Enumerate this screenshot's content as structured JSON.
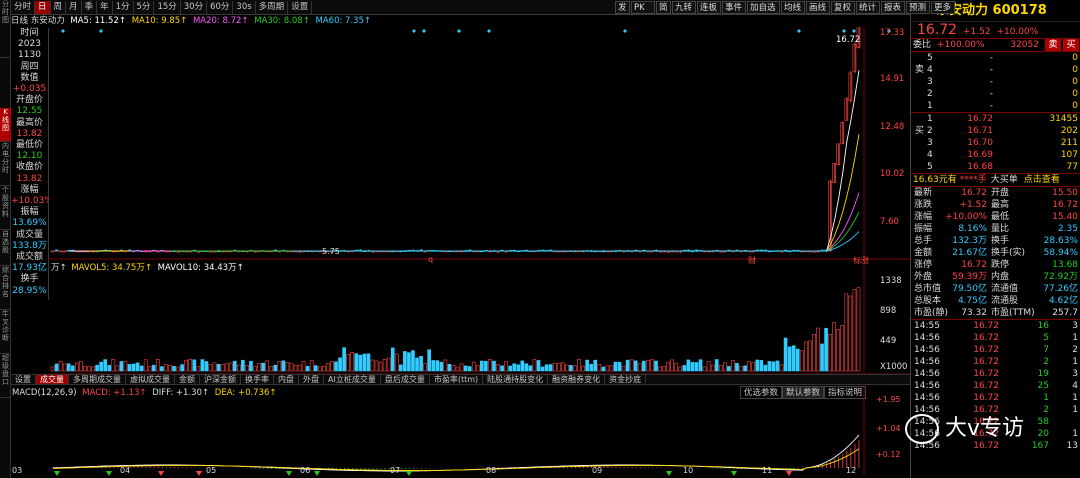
{
  "sidebar": {
    "tabs": [
      "分时图",
      "K线图",
      "内电分时",
      "个股资料",
      "自选股",
      "综合排名",
      "牛叉诊断",
      "超级盘口"
    ]
  },
  "toolbar": {
    "periods": [
      "分时",
      "日",
      "周",
      "月",
      "季",
      "年",
      "1分",
      "5分",
      "15分",
      "30分",
      "60分",
      "30s",
      "多周期",
      "设置"
    ],
    "selected": "日",
    "right_buttons": [
      "发",
      "PK",
      "简",
      "九转",
      "连板",
      "事件",
      "加自选",
      "均线",
      "画线",
      "复权",
      "统计",
      "报表",
      "预测",
      "更多"
    ]
  },
  "ma_bar": {
    "label": "日线 东安动力",
    "ma5": "MA5: 11.52↑",
    "ma10": "MA10: 9.85↑",
    "ma20": "MA20: 8.72↑",
    "ma30": "MA30: 8.08↑",
    "ma60": "MA60: 7.35↑"
  },
  "left_info": {
    "time_label": "时间",
    "year": "2023",
    "date": "1130",
    "weekday": "周四",
    "value_label": "数值",
    "value": "+0.035",
    "open_label": "开盘价",
    "open": "12.55",
    "high_label": "最高价",
    "high": "13.82",
    "low_label": "最低价",
    "low": "12.10",
    "close_label": "收盘价",
    "close": "13.82",
    "change_label": "涨幅",
    "change": "+10.03%",
    "amplitude_label": "振幅",
    "amplitude": "13.69%",
    "volume_label": "成交量",
    "volume": "133.8万",
    "amount_label": "成交额",
    "amount": "17.93亿",
    "turnover_label": "换手",
    "turnover": "28.95%"
  },
  "price_axis": [
    "17.33",
    "14.91",
    "12.48",
    "10.02",
    "7.60"
  ],
  "price_current_tag": "16.72",
  "low_marker": "5.75",
  "vol_header": {
    "prefix": "万↑",
    "mavol5": "MAVOL5: 34.75万↑",
    "mavol10": "MAVOL10: 34.43万↑"
  },
  "vol_axis": [
    "1338",
    "898",
    "449",
    "X1000"
  ],
  "indicator_tabs": [
    "设置",
    "成交量",
    "多周期成交量",
    "虚拟成交量",
    "金额",
    "沪深金额",
    "换手率",
    "内盘",
    "外盘",
    "AI立桩成交量",
    "盘后成交量",
    "市盈率(ttm)",
    "陆股通持股变化",
    "融资融券变化",
    "资金抄底"
  ],
  "indicator_selected": "成交量",
  "macd_header": {
    "name": "MACD(12,26,9)",
    "macd": "MACD: +1.13↑",
    "diff": "DIFF: +1.30↑",
    "dea": "DEA: +0.736↑"
  },
  "macd_buttons": [
    "优选参数",
    "默认参数",
    "指标说明"
  ],
  "macd_axis": [
    "+1.95",
    "+1.04",
    "+0.12"
  ],
  "months": [
    "03",
    "04",
    "05",
    "06",
    "07",
    "08",
    "09",
    "10",
    "11",
    "12"
  ],
  "chart_markers": {
    "q": "q",
    "cai": "财",
    "zhangting": "标涨"
  },
  "quote": {
    "name": "东安动力",
    "code": "600178",
    "price": "16.72",
    "change": "+1.52",
    "pct": "+10.00%",
    "weibi_label": "委比",
    "weibi": "+100.00%",
    "weicha": "32052",
    "sell_label": "卖",
    "buy_label": "买",
    "asks": [
      {
        "lvl": "5",
        "price": "-",
        "vol": "0"
      },
      {
        "lvl": "4",
        "price": "-",
        "vol": "0"
      },
      {
        "lvl": "3",
        "price": "-",
        "vol": "0"
      },
      {
        "lvl": "2",
        "price": "-",
        "vol": "0"
      },
      {
        "lvl": "1",
        "price": "-",
        "vol": "0"
      }
    ],
    "bids": [
      {
        "lvl": "1",
        "price": "16.72",
        "vol": "31455"
      },
      {
        "lvl": "2",
        "price": "16.71",
        "vol": "202"
      },
      {
        "lvl": "3",
        "price": "16.70",
        "vol": "211"
      },
      {
        "lvl": "4",
        "price": "16.69",
        "vol": "107"
      },
      {
        "lvl": "5",
        "price": "16.68",
        "vol": "77"
      }
    ],
    "big_buy": {
      "a": "16.63元有",
      "b": "****手",
      "c": "大买单",
      "d": "点击查看"
    },
    "stats": [
      [
        "最新",
        "16.72",
        "开盘",
        "15.50"
      ],
      [
        "涨跌",
        "+1.52",
        "最高",
        "16.72"
      ],
      [
        "涨幅",
        "+10.00%",
        "最低",
        "15.40"
      ],
      [
        "振幅",
        "8.16%",
        "量比",
        "2.35"
      ],
      [
        "总手",
        "132.3万",
        "换手",
        "28.63%"
      ],
      [
        "金额",
        "21.67亿",
        "换手(实)",
        "58.94%"
      ],
      [
        "涨停",
        "16.72",
        "跌停",
        "13.68"
      ],
      [
        "外盘",
        "59.39万",
        "内盘",
        "72.92万"
      ],
      [
        "总市值",
        "79.50亿",
        "流通值",
        "77.26亿"
      ],
      [
        "总股本",
        "4.75亿",
        "流通股",
        "4.62亿"
      ],
      [
        "市盈(静)",
        "73.32",
        "市盈(TTM)",
        "257.7"
      ]
    ],
    "ticks": [
      {
        "t": "14:55",
        "p": "16.72",
        "v": "16",
        "d": "3"
      },
      {
        "t": "14:56",
        "p": "16.72",
        "v": "5",
        "d": "1"
      },
      {
        "t": "14:56",
        "p": "16.72",
        "v": "7",
        "d": "2"
      },
      {
        "t": "14:56",
        "p": "16.72",
        "v": "2",
        "d": "1"
      },
      {
        "t": "14:56",
        "p": "16.72",
        "v": "19",
        "d": "3"
      },
      {
        "t": "14:56",
        "p": "16.72",
        "v": "25",
        "d": "4"
      },
      {
        "t": "14:56",
        "p": "16.72",
        "v": "1",
        "d": "1"
      },
      {
        "t": "14:56",
        "p": "16.72",
        "v": "2",
        "d": "1"
      },
      {
        "t": "14:56",
        "p": "16.72",
        "v": "58",
        "d": ""
      },
      {
        "t": "14:56",
        "p": "16.72",
        "v": "20",
        "d": "1"
      },
      {
        "t": "14:56",
        "p": "16.72",
        "v": "167",
        "d": "13"
      }
    ]
  },
  "watermark": "大v专访",
  "colors": {
    "up": "#ff4444",
    "down": "#22cc22",
    "cyan": "#33ccff",
    "bg": "#000000",
    "accent": "#b00000"
  }
}
